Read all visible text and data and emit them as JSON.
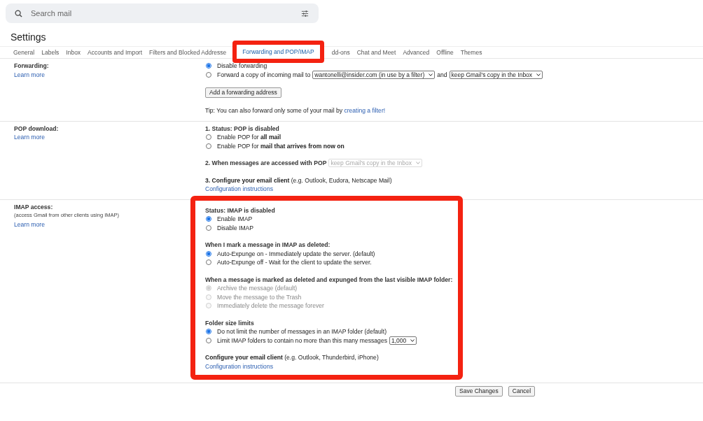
{
  "search": {
    "placeholder": "Search mail"
  },
  "title": "Settings",
  "tabs": [
    {
      "label": "General",
      "selected": false,
      "highlighted": false
    },
    {
      "label": "Labels",
      "selected": false,
      "highlighted": false
    },
    {
      "label": "Inbox",
      "selected": false,
      "highlighted": false
    },
    {
      "label": "Accounts and Import",
      "selected": false,
      "highlighted": false
    },
    {
      "label": "Filters and Blocked Addresse",
      "selected": false,
      "highlighted": false
    },
    {
      "label": "Forwarding and POP/IMAP",
      "selected": true,
      "highlighted": true
    },
    {
      "label": "dd-ons",
      "selected": false,
      "highlighted": false
    },
    {
      "label": "Chat and Meet",
      "selected": false,
      "highlighted": false
    },
    {
      "label": "Advanced",
      "selected": false,
      "highlighted": false
    },
    {
      "label": "Offline",
      "selected": false,
      "highlighted": false
    },
    {
      "label": "Themes",
      "selected": false,
      "highlighted": false
    }
  ],
  "sections": [
    {
      "label": "Forwarding:",
      "link": "Learn more",
      "highlighted": false,
      "groups": [
        [
          {
            "kind": "radio",
            "label": "Disable forwarding",
            "selected": true,
            "disabled": false
          },
          {
            "kind": "radio",
            "label": "Forward a copy of incoming mail to",
            "selected": false,
            "disabled": false,
            "controls": [
              {
                "kind": "select",
                "value": "wantonelli@insider.com (in use by a filter)",
                "disabled": false
              },
              {
                "kind": "text",
                "text": "and"
              },
              {
                "kind": "select",
                "value": "keep Gmail's copy in the Inbox",
                "disabled": false
              }
            ]
          }
        ],
        [
          {
            "kind": "button",
            "label": "Add a forwarding address"
          }
        ],
        [
          {
            "kind": "tip",
            "text": "Tip: You can also forward only some of your mail by",
            "link": "creating a filter!"
          }
        ]
      ]
    },
    {
      "label": "POP download:",
      "link": "Learn more",
      "highlighted": false,
      "groups": [
        [
          {
            "kind": "heading",
            "text": "1. Status: POP is disabled"
          },
          {
            "kind": "radio",
            "label": "Enable POP for **all mail**",
            "selected": false,
            "disabled": false
          },
          {
            "kind": "radio",
            "label": "Enable POP for **mail that arrives from now on**",
            "selected": false,
            "disabled": false
          }
        ],
        [
          {
            "kind": "select-line",
            "text": "2. When messages are accessed with POP",
            "select": {
              "value": "keep Gmail's copy in the Inbox",
              "disabled": true
            }
          }
        ],
        [
          {
            "kind": "text",
            "text": "**3. Configure your email client** (e.g. Outlook, Eudora, Netscape Mail)"
          },
          {
            "kind": "link",
            "text": "Configuration instructions"
          }
        ]
      ]
    },
    {
      "label": "IMAP access:",
      "note": "(access Gmail from other clients using IMAP)",
      "link": "Learn more",
      "highlighted": true,
      "groups": [
        [
          {
            "kind": "heading",
            "text": "Status: IMAP is disabled"
          },
          {
            "kind": "radio",
            "label": "Enable IMAP",
            "selected": true,
            "disabled": false
          },
          {
            "kind": "radio",
            "label": "Disable IMAP",
            "selected": false,
            "disabled": false
          }
        ],
        [
          {
            "kind": "heading",
            "text": "When I mark a message in IMAP as deleted:"
          },
          {
            "kind": "radio",
            "label": "Auto-Expunge on - Immediately update the server. (default)",
            "selected": true,
            "disabled": false
          },
          {
            "kind": "radio",
            "label": "Auto-Expunge off - Wait for the client to update the server.",
            "selected": false,
            "disabled": false
          }
        ],
        [
          {
            "kind": "heading",
            "text": "When a message is marked as deleted and expunged from the last visible IMAP folder:"
          },
          {
            "kind": "radio",
            "label": "Archive the message (default)",
            "selected": true,
            "disabled": true
          },
          {
            "kind": "radio",
            "label": "Move the message to the Trash",
            "selected": false,
            "disabled": true
          },
          {
            "kind": "radio",
            "label": "Immediately delete the message forever",
            "selected": false,
            "disabled": true
          }
        ],
        [
          {
            "kind": "heading",
            "text": "Folder size limits"
          },
          {
            "kind": "radio",
            "label": "Do not limit the number of messages in an IMAP folder (default)",
            "selected": true,
            "disabled": false
          },
          {
            "kind": "radio",
            "label": "Limit IMAP folders to contain no more than this many messages",
            "selected": false,
            "disabled": false,
            "controls": [
              {
                "kind": "select",
                "value": "1,000",
                "disabled": false
              }
            ]
          }
        ],
        [
          {
            "kind": "text",
            "text": "**Configure your email client** (e.g. Outlook, Thunderbird, iPhone)"
          },
          {
            "kind": "link",
            "text": "Configuration instructions"
          }
        ]
      ]
    }
  ],
  "footer_buttons": [
    "Save Changes",
    "Cancel"
  ]
}
